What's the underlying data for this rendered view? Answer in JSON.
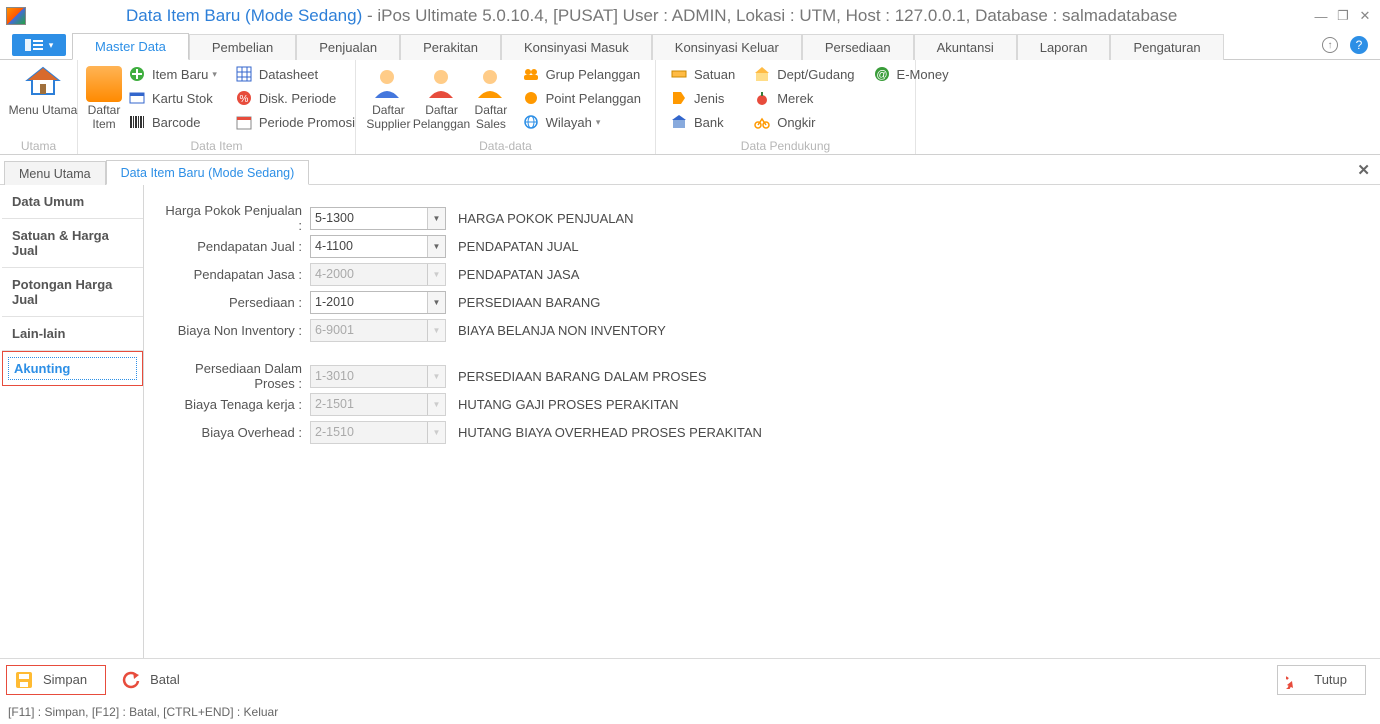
{
  "title": {
    "blue": "Data Item Baru (Mode Sedang)",
    "grey": " - iPos Ultimate 5.0.10.4, [PUSAT] User : ADMIN, Lokasi : UTM, Host : 127.0.0.1, Database : salmadatabase"
  },
  "window_buttons": {
    "min": "—",
    "restore": "❐",
    "close": "✕"
  },
  "ribbon_tabs": [
    "Master Data",
    "Pembelian",
    "Penjualan",
    "Perakitan",
    "Konsinyasi Masuk",
    "Konsinyasi Keluar",
    "Persediaan",
    "Akuntansi",
    "Laporan",
    "Pengaturan"
  ],
  "ribbon": {
    "menu_utama": "Menu Utama",
    "daftar_item": "Daftar\nItem",
    "item_baru": "Item Baru",
    "kartu_stok": "Kartu Stok",
    "barcode": "Barcode",
    "datasheet": "Datasheet",
    "disk_periode": "Disk. Periode",
    "periode_promosi": "Periode Promosi",
    "daftar_supplier": "Daftar\nSupplier",
    "daftar_pelanggan": "Daftar\nPelanggan",
    "daftar_sales": "Daftar\nSales",
    "grup_pelanggan": "Grup Pelanggan",
    "point_pelanggan": "Point Pelanggan",
    "wilayah": "Wilayah",
    "satuan": "Satuan",
    "jenis": "Jenis",
    "bank": "Bank",
    "dept_gudang": "Dept/Gudang",
    "merek": "Merek",
    "ongkir": "Ongkir",
    "emoney": "E-Money",
    "group_utama": "Utama",
    "group_data_item": "Data Item",
    "group_data_data": "Data-data",
    "group_data_pendukung": "Data Pendukung"
  },
  "doc_tabs": {
    "menu_utama": "Menu Utama",
    "data_item_baru": "Data Item Baru (Mode Sedang)"
  },
  "side_nav": [
    "Data Umum",
    "Satuan & Harga Jual",
    "Potongan Harga Jual",
    "Lain-lain",
    "Akunting"
  ],
  "form": {
    "rows": [
      {
        "label": "Harga Pokok Penjualan :",
        "value": "5-1300",
        "desc": "HARGA POKOK PENJUALAN",
        "disabled": false
      },
      {
        "label": "Pendapatan Jual :",
        "value": "4-1100",
        "desc": "PENDAPATAN JUAL",
        "disabled": false
      },
      {
        "label": "Pendapatan Jasa :",
        "value": "4-2000",
        "desc": "PENDAPATAN JASA",
        "disabled": true
      },
      {
        "label": "Persediaan :",
        "value": "1-2010",
        "desc": "PERSEDIAAN BARANG",
        "disabled": false
      },
      {
        "label": "Biaya Non Inventory :",
        "value": "6-9001",
        "desc": "BIAYA BELANJA NON INVENTORY",
        "disabled": true
      }
    ],
    "rows2": [
      {
        "label": "Persediaan Dalam Proses :",
        "value": "1-3010",
        "desc": "PERSEDIAAN BARANG DALAM PROSES",
        "disabled": true
      },
      {
        "label": "Biaya Tenaga kerja :",
        "value": "2-1501",
        "desc": "HUTANG GAJI PROSES PERAKITAN",
        "disabled": true
      },
      {
        "label": "Biaya Overhead :",
        "value": "2-1510",
        "desc": "HUTANG BIAYA OVERHEAD PROSES PERAKITAN",
        "disabled": true
      }
    ]
  },
  "buttons": {
    "simpan": "Simpan",
    "batal": "Batal",
    "tutup": "Tutup"
  },
  "status": "[F11] : Simpan, [F12] : Batal, [CTRL+END] : Keluar"
}
